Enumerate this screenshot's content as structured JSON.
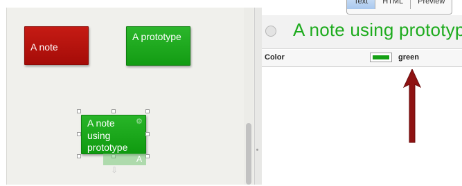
{
  "canvas": {
    "notes": [
      {
        "text": "A note",
        "color": "#b8120d"
      },
      {
        "text": "A prototype",
        "color": "#1fa91f"
      },
      {
        "text": "A note using prototype",
        "color": "#1fa91f"
      }
    ],
    "ghost_label": "A"
  },
  "inspector": {
    "tabs": [
      "Text",
      "HTML",
      "Preview"
    ],
    "active_tab": "Text",
    "note_title": "A note using prototype",
    "attribute": {
      "label": "Color",
      "value": "green",
      "swatch_color": "#14a014"
    }
  },
  "annotation": {
    "arrow_color": "#8e1212"
  }
}
